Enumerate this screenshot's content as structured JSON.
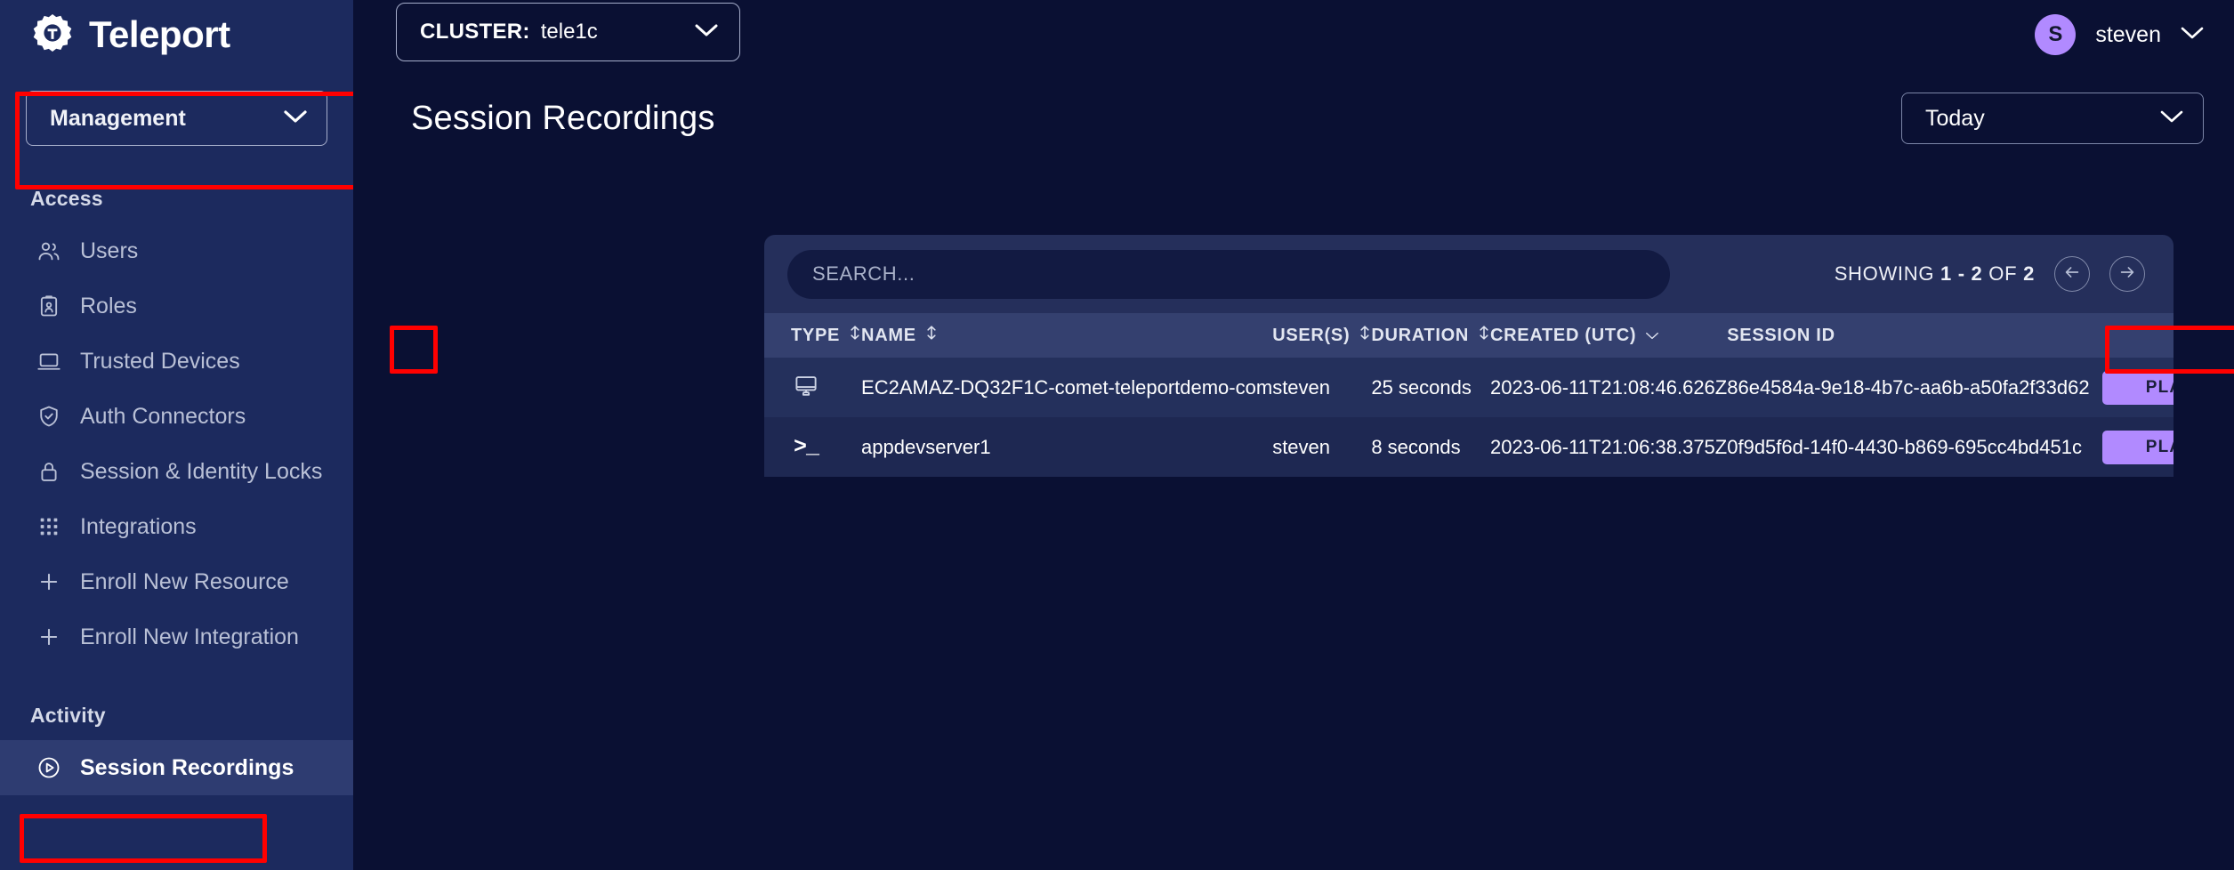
{
  "brand": {
    "name": "Teleport",
    "logo_icon": "teleport-gear-logo"
  },
  "sidebar": {
    "management_select": {
      "label": "Management",
      "icon": "chevron-down-icon"
    },
    "sections": [
      {
        "title": "Access",
        "items": [
          {
            "label": "Users",
            "icon": "users-icon",
            "active": false
          },
          {
            "label": "Roles",
            "icon": "clipboard-user-icon",
            "active": false
          },
          {
            "label": "Trusted Devices",
            "icon": "laptop-icon",
            "active": false
          },
          {
            "label": "Auth Connectors",
            "icon": "shield-check-icon",
            "active": false
          },
          {
            "label": "Session & Identity Locks",
            "icon": "lock-icon",
            "active": false
          },
          {
            "label": "Integrations",
            "icon": "grid-dots-icon",
            "active": false
          },
          {
            "label": "Enroll New Resource",
            "icon": "plus-icon",
            "active": false
          },
          {
            "label": "Enroll New Integration",
            "icon": "plus-icon",
            "active": false
          }
        ]
      },
      {
        "title": "Activity",
        "items": [
          {
            "label": "Session Recordings",
            "icon": "play-circle-icon",
            "active": true
          }
        ]
      }
    ]
  },
  "topbar": {
    "cluster_label": "CLUSTER:",
    "cluster_value": "tele1c",
    "cluster_chevron_icon": "chevron-down-icon",
    "user": {
      "initial": "S",
      "name": "steven",
      "chevron_icon": "chevron-down-icon"
    }
  },
  "page": {
    "title": "Session Recordings",
    "range_select": {
      "value": "Today",
      "icon": "chevron-down-icon"
    }
  },
  "search": {
    "placeholder": "SEARCH...",
    "value": ""
  },
  "pagination": {
    "text_prefix": "SHOWING ",
    "range": "1 - 2",
    "text_middle": " OF ",
    "total": "2",
    "prev_icon": "arrow-left-icon",
    "next_icon": "arrow-right-icon"
  },
  "table": {
    "columns": [
      {
        "key": "type",
        "label": "TYPE",
        "sort_icon": "sort-updown-icon"
      },
      {
        "key": "name",
        "label": "NAME",
        "sort_icon": "sort-updown-icon"
      },
      {
        "key": "users",
        "label": "USER(S)",
        "sort_icon": "sort-updown-icon"
      },
      {
        "key": "duration",
        "label": "DURATION",
        "sort_icon": "sort-updown-icon"
      },
      {
        "key": "created",
        "label": "CREATED (UTC)",
        "sort_icon": "chevron-down-icon"
      },
      {
        "key": "session_id",
        "label": "SESSION ID",
        "sort_icon": ""
      },
      {
        "key": "play",
        "label": "",
        "sort_icon": ""
      }
    ],
    "rows": [
      {
        "type_icon": "desktop-monitor-icon",
        "name": "EC2AMAZ-DQ32F1C-comet-teleportdemo-com",
        "users": "steven",
        "duration": "25 seconds",
        "created": "2023-06-11T21:08:46.626Z",
        "session_id": "86e4584a-9e18-4b7c-aa6b-a50fa2f33d62",
        "play_label": "PLAY"
      },
      {
        "type_icon": "terminal-prompt-icon",
        "name": "appdevserver1",
        "users": "steven",
        "duration": "8 seconds",
        "created": "2023-06-11T21:06:38.375Z",
        "session_id": "0f9d5f6d-14f0-4430-b869-695cc4bd451c",
        "play_label": "PLAY"
      }
    ]
  },
  "colors": {
    "accent_purple": "#b18aff",
    "sidebar_bg": "#1c2a5e",
    "main_bg": "#0a1033",
    "card_bg": "#252f5b",
    "table_header_bg": "#34406f",
    "highlight_red": "#ff0000"
  }
}
